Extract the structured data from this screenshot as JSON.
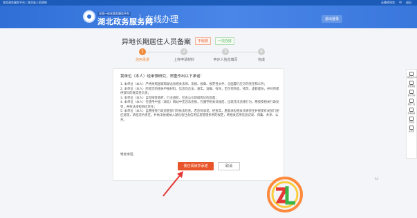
{
  "topbar": {
    "left": "湖北政务服务平台 | 湖北省人民政府",
    "right": [
      "无障碍浏览",
      "中",
      "退出"
    ]
  },
  "header": {
    "logo_top": "全国一体化政务服务平台",
    "logo_main": "湖北政务服务网",
    "section": "在线办理",
    "login": "退出登录"
  },
  "page": {
    "title": "异地长期居住人员备案",
    "badge_fee": "不收费",
    "badge_once": "一次办好"
  },
  "steps": [
    {
      "num": "1",
      "label": "信用承诺"
    },
    {
      "num": "2",
      "label": "上传申请材料"
    },
    {
      "num": "3",
      "label": "申办人信息填写"
    },
    {
      "num": "4",
      "label": "完成"
    }
  ],
  "commitment": {
    "intro": "我单位（本人）经审慎研究，郑重作出以下承诺：",
    "items": [
      "1. 本单位（本人）严格依照国家和湖北省相关法律、法规、规章、规范性文件，全面履行应尽的责任和义务；",
      "2. 本单位（本人）所提交的相关申报材料、信息均合法、真实、准确、有效，无任何伪造、修改、虚假成份，并对所提供资料的真实性负责；",
      "3. 本单位（本人）自觉接受政府、行业组织、社会公众新闻舆论的监督；",
      "4. 本单位（本人）在使用中国（湖北）网站中无违法违规，在遵守相关法规后，出现违法违规行为，愿接受相关行政处罚，并依法承担相应责任；",
      "5. 本单位（本人）自愿接受行政监管部门的依法检查。若违背承诺，经查实，愿意承担相关法律责任并接受有关部门相应处理，承担违约责任，并依法依规纳入湖北省社会信用信息管理条例的规定，将相关信用信息记录、归集、共享、公开。"
    ],
    "closing": "特此承诺。",
    "agree_button": "我已阅读并承诺",
    "cancel_button": "取消"
  },
  "sidebar": [
    {
      "icon": "phone-icon",
      "label": "湖北政务APP"
    },
    {
      "icon": "headset-icon",
      "label": "智能客服"
    },
    {
      "icon": "chat-icon",
      "label": "留言咨询"
    },
    {
      "icon": "doc-icon",
      "label": "我的一窗"
    },
    {
      "icon": "star-icon",
      "label": "办事指南"
    },
    {
      "icon": "accessible-icon",
      "label": "无障碍"
    },
    {
      "icon": "top-icon",
      "label": "返顶部"
    }
  ],
  "colors": {
    "primary_blue": "#2f6fd6",
    "accent_orange": "#f08a3a",
    "agree_red": "#e9552b"
  }
}
